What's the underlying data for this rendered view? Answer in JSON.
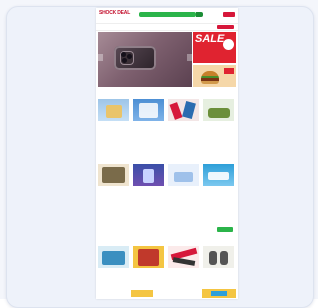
{
  "header": {
    "logo": "SHOCK DEAL",
    "search_placeholder": "",
    "links": [
      "",
      ""
    ],
    "cart_label": ""
  },
  "nav": {
    "items": [
      "",
      "",
      "",
      "",
      "",
      "",
      ""
    ]
  },
  "banner": {
    "caption": "",
    "side_promo": "SALE",
    "side_promo_sub": ""
  },
  "sections": [
    {
      "title": ""
    },
    {
      "title": ""
    }
  ],
  "products_row1": [
    {
      "price": "",
      "old": "",
      "meta": ""
    },
    {
      "price": "",
      "old": "",
      "meta": ""
    },
    {
      "price": "",
      "old": "",
      "meta": ""
    },
    {
      "price": "",
      "old": "",
      "meta": ""
    }
  ],
  "products_row2": [
    {
      "price": "",
      "old": "",
      "meta": ""
    },
    {
      "price": "",
      "old": "",
      "meta": ""
    },
    {
      "price": "",
      "old": "",
      "meta": ""
    },
    {
      "price": "",
      "old": "",
      "meta": ""
    }
  ],
  "products_row3": [
    {
      "price": ""
    },
    {
      "price": ""
    },
    {
      "price": ""
    },
    {
      "price": ""
    }
  ],
  "view_more": "",
  "colors": {
    "brand_red": "#d6173a",
    "search_green": "#2bb44a",
    "card_bg": "#eef2fa"
  }
}
